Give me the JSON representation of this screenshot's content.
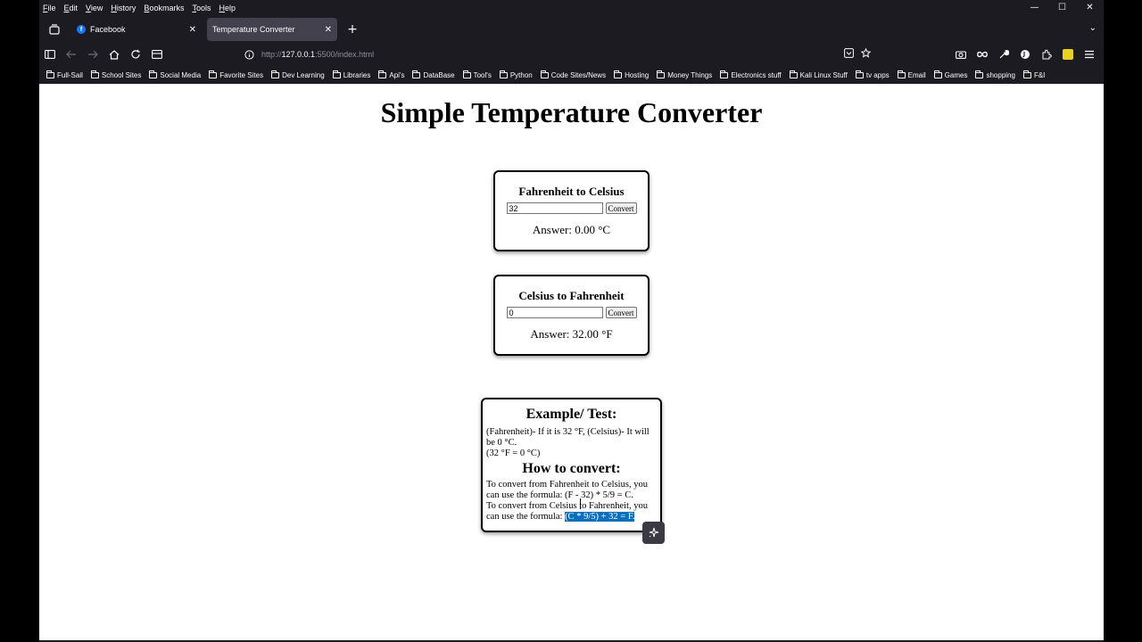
{
  "menubar": {
    "items": [
      "File",
      "Edit",
      "View",
      "History",
      "Bookmarks",
      "Tools",
      "Help"
    ]
  },
  "window_controls": {
    "minimize": "—",
    "maximize": "☐",
    "close": "✕"
  },
  "tabs": [
    {
      "title": "Facebook",
      "favicon": "f"
    },
    {
      "title": "Temperature Converter"
    }
  ],
  "tab_controls": {
    "close": "✕",
    "new_tab": "+",
    "overflow": "⌄"
  },
  "urlbar": {
    "scheme": "http://",
    "host": "127.0.0.1",
    "rest": ":5500/index.html"
  },
  "bookmarks": [
    "Full-Sail",
    "School Sites",
    "Social Media",
    "Favorite  Sites",
    "Dev Learning",
    "Libraries",
    "Api's",
    "DataBase",
    "Tool's",
    "Python",
    "Code Sites/News",
    "Hosting",
    "Money Things",
    "Electronics stuff",
    "Kali Linux Stuff",
    "tv apps",
    "Email",
    "Games",
    "shopping",
    "F&I"
  ],
  "page": {
    "title": "Simple Temperature Converter",
    "f2c": {
      "heading": "Fahrenheit to Celsius",
      "input_value": "32",
      "button": "Convert",
      "answer": "Answer: 0.00 °C"
    },
    "c2f": {
      "heading": "Celsius to Fahrenheit",
      "input_value": "0",
      "button": "Convert",
      "answer": "Answer: 32.00 °F"
    },
    "info": {
      "example_heading": "Example/ Test:",
      "example_line1": "(Fahrenheit)- If it is 32 °F, (Celsius)- It will be 0 °C.",
      "example_line2": "(32 °F = 0 °C)",
      "howto_heading": "How to convert:",
      "howto_line1": "To convert from Fahrenheit to Celsius, you can use the formula: (F - 32) * 5/9 = C.",
      "howto_line2_prefix": "To convert from Celsius to Fahrenheit, you can use the formula: ",
      "howto_line2_selected": "(C * 9/5) + 32 = F."
    }
  },
  "colors": {
    "chrome_bg": "#1c1b22",
    "active_tab": "#42414d",
    "selection": "#0a6fbd"
  }
}
